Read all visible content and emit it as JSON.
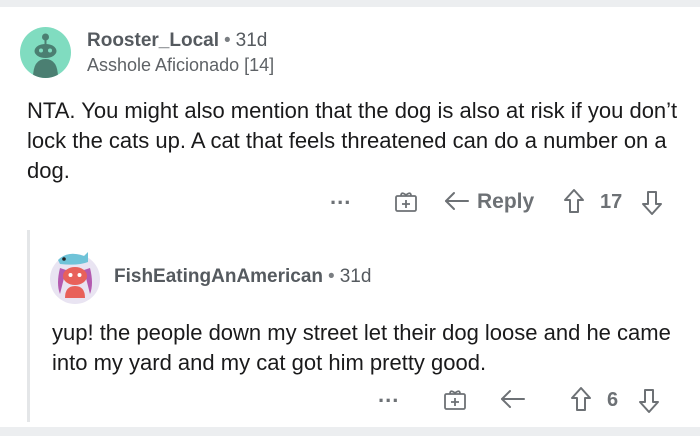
{
  "comment1": {
    "username": "Rooster_Local",
    "separator": "•",
    "age": "31d",
    "flair": "Asshole Aficionado [14]",
    "body": "NTA. You might also mention that the dog is also at risk if you don’t lock the cats up. A cat that feels threatened can do a number on a dog.",
    "actions": {
      "more": "...",
      "reply_label": "Reply",
      "score": "17"
    }
  },
  "comment2": {
    "username": "FishEatingAnAmerican",
    "separator": "•",
    "age": "31d",
    "body": "yup! the people down my street let their dog loose and he came into my yard and my cat got him pretty good.",
    "actions": {
      "more": "...",
      "score": "6"
    }
  },
  "colors": {
    "avatar1_bg": "#80dcc0",
    "meta_text": "#555a5f",
    "icon": "#6d7175",
    "thread_line": "#e4e6e8"
  },
  "icons": [
    "snoo-avatar",
    "more-icon",
    "gift-icon",
    "reply-icon",
    "upvote-icon",
    "downvote-icon"
  ]
}
